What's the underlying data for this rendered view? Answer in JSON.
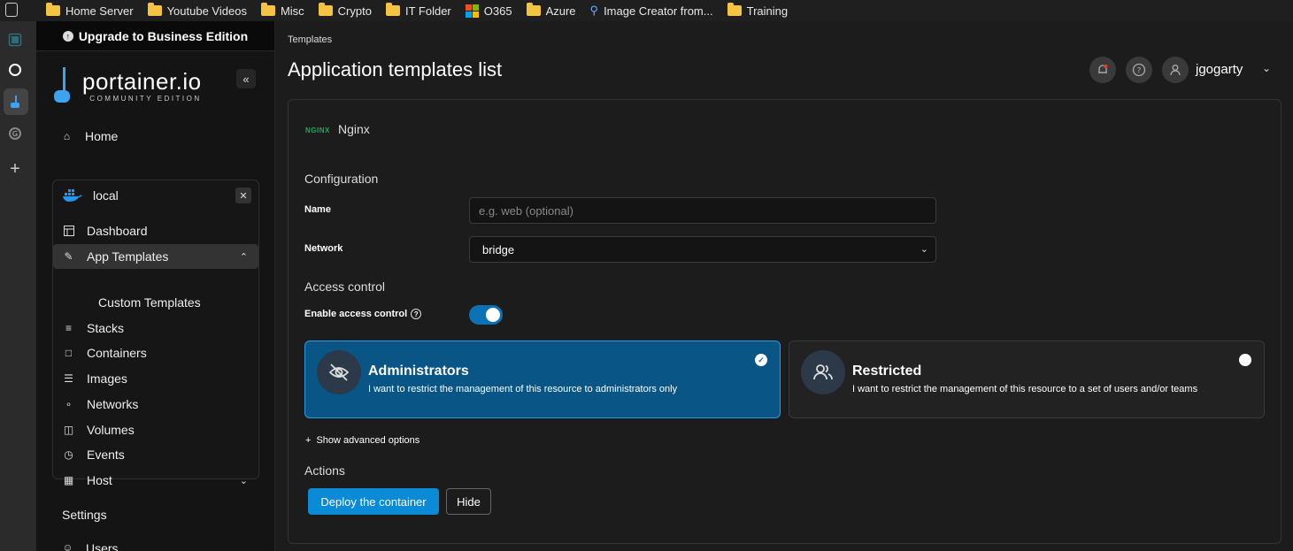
{
  "bookmarks": [
    {
      "label": "Home Server",
      "icon": "folder-icon"
    },
    {
      "label": "Youtube Videos",
      "icon": "folder-icon"
    },
    {
      "label": "Misc",
      "icon": "folder-icon"
    },
    {
      "label": "Crypto",
      "icon": "folder-icon"
    },
    {
      "label": "IT Folder",
      "icon": "folder-icon"
    },
    {
      "label": "O365",
      "icon": "microsoft-icon"
    },
    {
      "label": "Azure",
      "icon": "folder-icon"
    },
    {
      "label": "Image Creator from...",
      "icon": "search-icon"
    },
    {
      "label": "Training",
      "icon": "folder-icon"
    }
  ],
  "sidebar": {
    "upgrade_label": "Upgrade to Business Edition",
    "logo_text": "portainer.io",
    "logo_sub": "COMMUNITY EDITION",
    "home": "Home",
    "environment": "local",
    "items": {
      "dashboard": "Dashboard",
      "app_templates": "App Templates",
      "custom_templates": "Custom Templates",
      "stacks": "Stacks",
      "containers": "Containers",
      "images": "Images",
      "networks": "Networks",
      "volumes": "Volumes",
      "events": "Events",
      "host": "Host"
    },
    "settings": "Settings",
    "users": "Users"
  },
  "header": {
    "breadcrumb": "Templates",
    "title": "Application templates list",
    "username": "jgogarty"
  },
  "template": {
    "logo_text": "NGINX",
    "name": "Nginx",
    "configuration_heading": "Configuration",
    "name_label": "Name",
    "name_placeholder": "e.g. web (optional)",
    "network_label": "Network",
    "network_value": "bridge",
    "access_heading": "Access control",
    "enable_access_label": "Enable access control",
    "access_enabled": true,
    "options": {
      "admin_title": "Administrators",
      "admin_desc": "I want to restrict the management of this resource to administrators only",
      "restricted_title": "Restricted",
      "restricted_desc": "I want to restrict the management of this resource to a set of users and/or teams",
      "selected": "Administrators"
    },
    "advanced_label": "Show advanced options",
    "actions_heading": "Actions",
    "deploy_label": "Deploy the container",
    "hide_label": "Hide"
  },
  "colors": {
    "accent": "#0b8ad6",
    "selected_option": "#085586",
    "folder": "#f5c342",
    "nginx_green": "#22a65a"
  }
}
